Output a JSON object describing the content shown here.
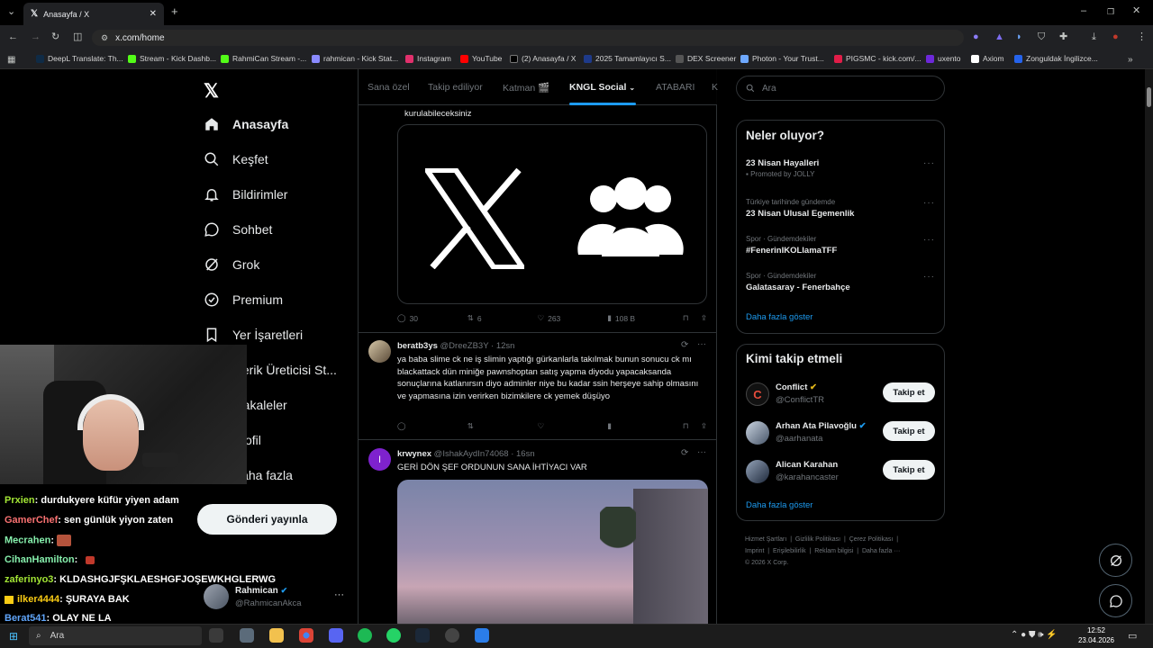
{
  "browser": {
    "tab_title": "Anasayfa / X",
    "url": "x.com/home",
    "bookmarks": [
      "DeepL Translate: Th...",
      "Stream - Kick Dashb...",
      "RahmiCan Stream -...",
      "rahmican - Kick Stat...",
      "Instagram",
      "YouTube",
      "(2) Anasayfa / X",
      "2025 Tamamlayıcı S...",
      "DEX Screener",
      "Photon - Your Trust...",
      "PIGSMC - kick.com/...",
      "uxento",
      "Axiom",
      "Zonguldak İngilizce..."
    ]
  },
  "sidebar": {
    "items": [
      {
        "label": "Anasayfa"
      },
      {
        "label": "Keşfet"
      },
      {
        "label": "Bildirimler"
      },
      {
        "label": "Sohbet"
      },
      {
        "label": "Grok"
      },
      {
        "label": "Premium"
      },
      {
        "label": "Yer İşaretleri"
      },
      {
        "label": "İçerik Üreticisi St..."
      },
      {
        "label": "Makaleler"
      },
      {
        "label": "Profil"
      },
      {
        "label": "Daha fazla"
      }
    ],
    "post_button": "Gönderi yayınla",
    "account": {
      "name": "Rahmican",
      "handle": "@RahmicanAkca"
    }
  },
  "timeline": {
    "tabs": [
      "Sana özel",
      "Takip ediliyor",
      "Katman 🎬",
      "KNGL Social",
      "ATABARI",
      "K"
    ],
    "tweet1": {
      "partial_text": "kurulabileceksiniz",
      "replies": "30",
      "reposts": "6",
      "likes": "263",
      "views": "108 B"
    },
    "tweet2": {
      "name": "beratb3ys",
      "handle": "@DreeZB3Y",
      "time": "12sn",
      "text": "ya baba slime ck ne iş slimin yaptığı gürkanlarla takılmak bunun sonucu ck mı blackattack dün miniğe pawnshoptan satış yapma diyodu yapacaksanda sonuçlarına katlanırsın diyo adminler niye bu kadar ssin herşeye sahip olmasını ve yapmasına izin verirken bizimkilere ck yemek düşüyo"
    },
    "tweet3": {
      "avatar_letter": "I",
      "name": "krwynex",
      "handle": "@IshakAydIn74068",
      "time": "16sn",
      "text": "GERİ DÖN ŞEF ORDUNUN SANA İHTİYACI VAR"
    }
  },
  "right": {
    "search_placeholder": "Ara",
    "trends_title": "Neler oluyor?",
    "trends": [
      {
        "category": "",
        "name": "23 Nisan Hayalleri",
        "promo": "Promoted by JOLLY"
      },
      {
        "category": "Türkiye tarihinde gündemde",
        "name": "23 Nisan Ulusal Egemenlik",
        "promo": ""
      },
      {
        "category": "Spor · Gündemdekiler",
        "name": "#FenerinIKOLlamaTFF",
        "promo": ""
      },
      {
        "category": "Spor · Gündemdekiler",
        "name": "Galatasaray - Fenerbahçe",
        "promo": ""
      }
    ],
    "show_more": "Daha fazla göster",
    "who_to_follow_title": "Kimi takip etmeli",
    "who_to_follow": [
      {
        "name": "Conflict",
        "handle": "@ConflictTR",
        "button": "Takip et"
      },
      {
        "name": "Arhan Ata Pilavoğlu",
        "handle": "@aarhanata",
        "button": "Takip et"
      },
      {
        "name": "Alican Karahan",
        "handle": "@karahancaster",
        "button": "Takip et"
      }
    ],
    "footer": [
      "Hizmet Şartları",
      "|",
      "Gizlilik Politikası",
      "|",
      "Çerez Politikası",
      "|",
      "Imprint",
      "|",
      "Erişilebilirlik",
      "|",
      "Reklam bilgisi",
      "|",
      "Daha fazla ···"
    ],
    "copyright": "© 2026 X Corp."
  },
  "chat": [
    {
      "user": "Prxien",
      "msg": ": durdukyere küfür yiyen adam",
      "color": "#a3e635"
    },
    {
      "user": "GamerChef",
      "msg": ": sen günlük yiyon zaten",
      "color": "#f87171"
    },
    {
      "user": "Mecrahen",
      "msg": ":",
      "color": "#86efac"
    },
    {
      "user": "CihanHamilton",
      "msg": ":",
      "color": "#86efac"
    },
    {
      "user": "zaferinyo3",
      "msg": ": KLDASHGJFŞKLAESHGFJOŞEWKHGLERWG",
      "color": "#a3e635"
    },
    {
      "user": "ilker4444",
      "msg": ": ŞURAYA BAK",
      "color": "#facc15"
    },
    {
      "user": "Berat541",
      "msg": ": OLAY NE LA",
      "color": "#60a5fa"
    }
  ],
  "taskbar": {
    "search": "Ara",
    "time": "12:52",
    "date": "23.04.2026"
  }
}
